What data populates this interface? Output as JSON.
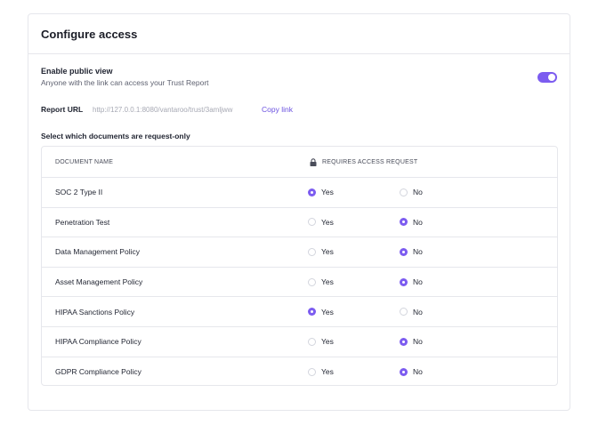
{
  "header": {
    "title": "Configure access"
  },
  "public_view": {
    "title": "Enable public view",
    "description": "Anyone with the link can access your Trust Report",
    "enabled": true,
    "accent_color": "#7c5cf0"
  },
  "report_url": {
    "label": "Report URL",
    "value": "http://127.0.0.1:8080/vantaroo/trust/3amljww",
    "copy_label": "Copy link"
  },
  "documents": {
    "section_label": "Select which documents are request-only",
    "col_name": "DOCUMENT NAME",
    "col_request": "REQUIRES ACCESS REQUEST",
    "yes_label": "Yes",
    "no_label": "No",
    "rows": [
      {
        "name": "SOC 2 Type II",
        "requires_request": true
      },
      {
        "name": "Penetration Test",
        "requires_request": false
      },
      {
        "name": "Data Management Policy",
        "requires_request": false
      },
      {
        "name": "Asset Management Policy",
        "requires_request": false
      },
      {
        "name": "HIPAA Sanctions Policy",
        "requires_request": true
      },
      {
        "name": "HIPAA Compliance Policy",
        "requires_request": false
      },
      {
        "name": "GDPR Compliance Policy",
        "requires_request": false
      }
    ]
  }
}
